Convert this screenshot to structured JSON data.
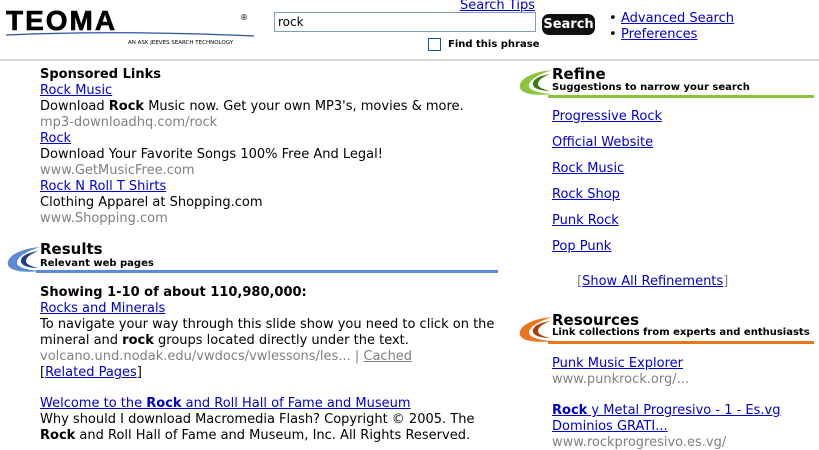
{
  "header": {
    "logo_text": "TEOMA",
    "logo_tagline": "AN ASK JEEVES SEARCH TECHNOLOGY",
    "search_value": "rock",
    "search_tips": "Search Tips",
    "search_button": "Search",
    "find_phrase": "Find this phrase",
    "bullet": "•",
    "advanced_search": "Advanced Search",
    "preferences": "Preferences"
  },
  "sponsored": {
    "heading": "Sponsored Links",
    "items": [
      {
        "title": "Rock Music",
        "desc_pre": "Download ",
        "desc_bold": "Rock",
        "desc_post": " Music now. Get your own MP3's, movies & more.",
        "url": "mp3-downloadhq.com/rock"
      },
      {
        "title": "Rock",
        "desc": "Download Your Favorite Songs 100% Free And Legal!",
        "url": "www.GetMusicFree.com"
      },
      {
        "title": "Rock N Roll T Shirts",
        "desc": "Clothing Apparel at Shopping.com",
        "url": "www.Shopping.com"
      }
    ]
  },
  "results": {
    "title": "Results",
    "subtitle": "Relevant web pages",
    "showing": "Showing 1-10 of about 110,980,000:",
    "items": [
      {
        "title": "Rocks and Minerals",
        "line1": "To navigate your way through this slide show you need to click on the",
        "line2_pre": "mineral and ",
        "line2_bold": "rock",
        "line2_post": " groups located directly under the text.",
        "url": "volcano.und.nodak.edu/vwdocs/vwlessons/les...",
        "sep": " | ",
        "cached": "Cached",
        "related_open": "[",
        "related": "Related Pages",
        "related_close": "]"
      },
      {
        "title_pre": "Welcome to the ",
        "title_bold": "Rock",
        "title_post": " and Roll Hall of Fame and Museum",
        "line1": "Why should I download Macromedia Flash? Copyright © 2005. The",
        "line2_bold": "Rock",
        "line2_post": " and Roll Hall of Fame and Museum, Inc. All Rights Reserved."
      }
    ]
  },
  "refine": {
    "title": "Refine",
    "subtitle": "Suggestions to narrow your search",
    "items": [
      "Progressive Rock",
      "Official Website",
      "Rock Music",
      "Rock Shop",
      "Punk Rock",
      "Pop Punk"
    ],
    "show_all_open": "[",
    "show_all": "Show All Refinements",
    "show_all_close": "]"
  },
  "resources": {
    "title": "Resources",
    "subtitle": "Link collections from experts and enthusiasts",
    "items": [
      {
        "title": "Punk Music Explorer",
        "url": "www.punkrock.org/..."
      },
      {
        "title_bold": "Rock",
        "title_post": " y Metal Progresivo - 1 - Es.vg",
        "line2": "Dominios GRATI...",
        "url": "www.rockprogresivo.es.vg/"
      }
    ]
  },
  "colors": {
    "link": "#0000cc",
    "url_gray": "#808080",
    "results_accent": "#5b8ad6",
    "refine_accent": "#8cc43c",
    "resources_accent": "#e8741c"
  }
}
